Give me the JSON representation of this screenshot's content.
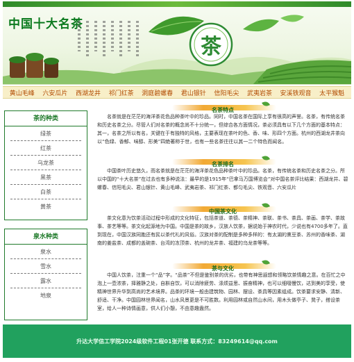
{
  "banner": {
    "site_title": "中国十大名茶",
    "emblem_char": "茶"
  },
  "nav": {
    "items": [
      "黄山毛峰",
      "六安瓜片",
      "西湖龙井",
      "祁门红茶",
      "洞庭碧螺春",
      "君山银针",
      "信阳毛尖",
      "武夷岩茶",
      "安溪铁观音",
      "太平猴魁"
    ]
  },
  "sidebar": {
    "tea_types": {
      "title": "茶的种类",
      "items": [
        "绿茶",
        "红茶",
        "乌龙茶",
        "黑茶",
        "白茶",
        "黄茶"
      ]
    },
    "water_types": {
      "title": "泉水种类",
      "items": [
        "泉水",
        "雪水",
        "露水",
        "地泉"
      ]
    }
  },
  "content": {
    "sections": [
      {
        "title": "名茶特点",
        "text": "名茶就是在茫茫的海洋茶花色品种茶叶中的珍品。同时，中国名茶在国际上享有很高的声誉。名茶，有传统名茶和历史名茶之分。尽管人们对名茶的概念尚不十分统一，但综合各方面情况，茶必须具有以下几个方面的基本特点：其一，名茶之所以有名，关键在于有独特的风格，主要表现在茶叶的色、香、味、形四个方面。杭州的西湖龙井茶向以“色绿、香郁、味醇、形美”四绝著称于世，也有一些名茶往往以其一二个特色而闻名。"
      },
      {
        "title": "名茶排名",
        "text": "中国茶叶历史悠久，而名茶就是在茫茫的海洋茶花色品种茶叶中的珍品。名茶，有传统名茶和历史名茶之分。所以中国的“十大名茶”在过去也有多种说法：最早的是1915年“巴拿马万国博览会”对中国名茶评比结果：西湖龙井、碧螺春、信阳毛尖、君山银针、黄山毛峰、武夷岩茶、祁门红茶、都匀毛尖、铁观音、六安瓜片"
      },
      {
        "title": "中国茶文化",
        "text": "茶文化意为饮茶活动过程中形成的文化特征，包括茶道、茶德、茶精神、茶联、茶书、茶具、茶画、茶学、茶故事、茶艺等等。茶文化起源地为中国。中国是茶的故乡，汉族人饮茶，据说始于神农时代，少说也有4700多年了。直到现在，中国汉族同胞还有民以茶代礼的风俗。汉族对茶的配制是多种多样的：有太湖的熏豆茶、苏州的香味茶、湖南的姜盐茶、成都的盖碗茶、台湾的冻顶茶、杭州的龙井茶、福建的乌龙茶等等。"
      },
      {
        "title": "茶与文化",
        "text": "中国人饮茶，注重一个“品”字。“品茶”不但是鉴别茶的优劣，也带有神思遐想和领略饮茶情趣之意。在百忙之中泡上一壶浓茶，择雅静之处，自斟自饮，可以消除疲劳、涤烦益思、振奋精神，也可以细啜慢饮，达到美的享受，使精神世界升华到高尚的艺术境界。品茶的环境一般由建筑物、园林、摆设、茶具等因素组成。饮茶要求安静、清新、舒适、干净。中国园林世界闻名，山水风景更是不可胜数。利用园林或自然山水间，用木头做亭子、凳子，搭设茶室，给人一种诗情画意，供人们小憩，不由意趣盎然。"
      }
    ]
  },
  "footer": {
    "text": "升达大学信工学院2024级软件工程01张开德 联系方式：83249614@qq.com"
  },
  "colors": {
    "title_green": "#0b7a1e",
    "nav_text": "#b14a00",
    "nav_bg": "#f8efc8",
    "sidebar_border": "#1f7a2a",
    "footer_bg": "#21a15e"
  }
}
